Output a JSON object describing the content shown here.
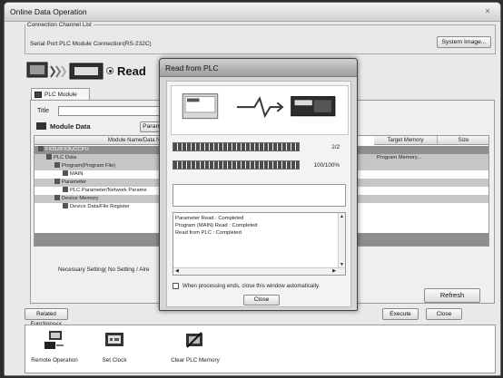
{
  "window": {
    "title": "Online Data Operation",
    "close_glyph": "×"
  },
  "connection": {
    "group_label": "Connection Channel List",
    "value": "Serial Port  PLC Module Connection(RS-232C)",
    "system_image_button": "System Image..."
  },
  "operation": {
    "selected_mode": "Read"
  },
  "tab": {
    "label": "PLC Module"
  },
  "title_field": {
    "label": "Title",
    "value": ""
  },
  "module_data": {
    "label": "Module Data",
    "param_button": "Parame"
  },
  "table": {
    "headers": [
      "Module Name/Data Name",
      "Target Memory",
      "Size"
    ],
    "rows": [
      {
        "indent": 0,
        "label": "FX3U/FX3UCCPU",
        "target": "",
        "style": "plc"
      },
      {
        "indent": 1,
        "label": "PLC Data",
        "target": "Program Memory...",
        "style": "sel"
      },
      {
        "indent": 2,
        "label": "Program(Program File)",
        "target": "",
        "style": "sel"
      },
      {
        "indent": 3,
        "label": "MAIN",
        "target": "",
        "style": ""
      },
      {
        "indent": 2,
        "label": "Parameter",
        "target": "",
        "style": "sel"
      },
      {
        "indent": 3,
        "label": "PLC Parameter/Network Parame",
        "target": "",
        "style": ""
      },
      {
        "indent": 2,
        "label": "Device Memory",
        "target": "",
        "style": "sel"
      },
      {
        "indent": 3,
        "label": "Device Data/File Register",
        "target": "",
        "style": ""
      }
    ]
  },
  "necessary_setting": "Necessary Setting(  No Setting  /  Alre",
  "buttons": {
    "refresh": "Refresh",
    "related": "Related Functions<<",
    "execute": "Execute",
    "close": "Close"
  },
  "related_functions": [
    {
      "icon": "remote-operation-icon",
      "label": "Remote Operation"
    },
    {
      "icon": "set-clock-icon",
      "label": "Set Clock"
    },
    {
      "icon": "clear-plc-memory-icon",
      "label": "Clear PLC Memory"
    }
  ],
  "dialog": {
    "title": "Read from PLC",
    "progress": [
      {
        "text": "2/2",
        "fraction": 1.0
      },
      {
        "text": "100/100%",
        "fraction": 1.0
      }
    ],
    "current_item": "",
    "log": [
      "Parameter Read : Completed",
      "Program (MAIN) Read : Completed",
      "Read from PLC : Completed"
    ],
    "auto_close_label": "When processing ends, close this window automatically.",
    "auto_close_checked": false,
    "close_button": "Close"
  },
  "colors": {
    "window_bg": "#e9e9e9",
    "dialog_bg": "#d6d6d6",
    "progress_fill": "#4b4b4b",
    "selected_row": "#8f8f8f"
  }
}
